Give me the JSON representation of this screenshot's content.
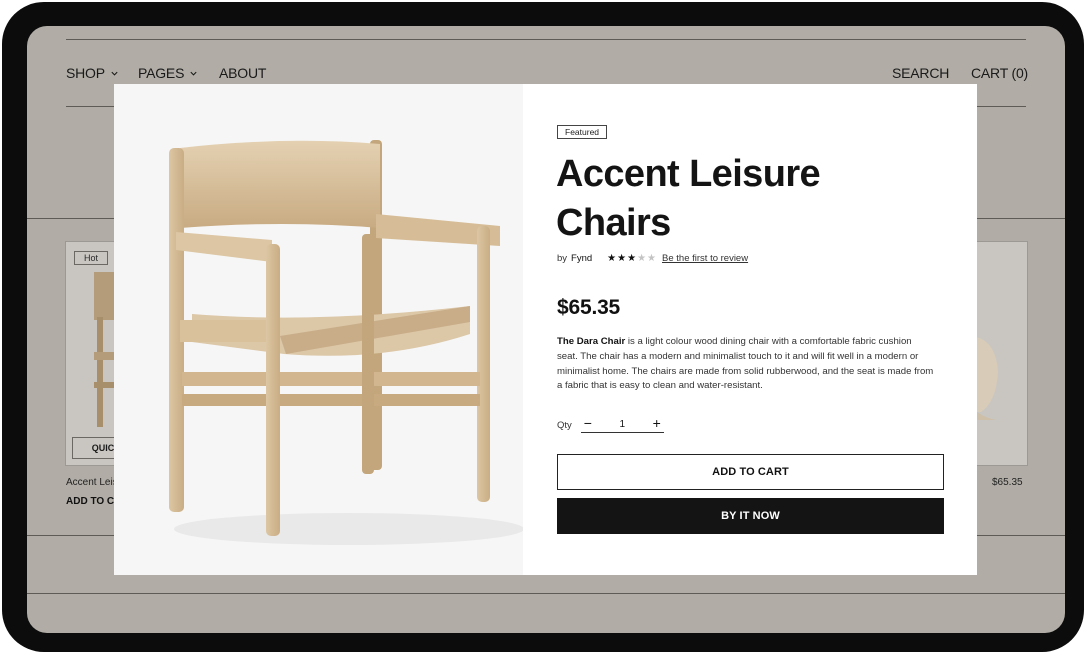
{
  "nav": {
    "shop": "SHOP",
    "pages": "PAGES",
    "about": "ABOUT",
    "search": "SEARCH",
    "cart": "CART (0)"
  },
  "background_products": {
    "left": {
      "badge": "Hot",
      "quick_label": "QUIC",
      "title": "Accent Leis",
      "add_to_cart": "ADD TO CA"
    },
    "right": {
      "price": "$65.35"
    }
  },
  "modal": {
    "badge": "Featured",
    "title": "Accent Leisure Chairs",
    "by_label": "by",
    "vendor": "Fynd",
    "rating": 3,
    "rating_max": 5,
    "review_link": "Be the first to review",
    "price": "$65.35",
    "description_lead": "The Dara Chair",
    "description_body": " is a light colour wood dining chair with a comfortable fabric cushion seat. The chair has a modern and minimalist touch to it and will fit well in a modern or minimalist home. The chairs are made from solid rubberwood, and the seat is made from a fabric that is easy to clean and water-resistant.",
    "qty_label": "Qty",
    "qty_value": "1",
    "add_to_cart": "ADD TO CART",
    "buy_now": "BY IT NOW"
  },
  "colors": {
    "overlay": "#b1ada6",
    "modal_bg": "#ffffff",
    "button_dark": "#141414",
    "wood": "#d9c3a2"
  }
}
